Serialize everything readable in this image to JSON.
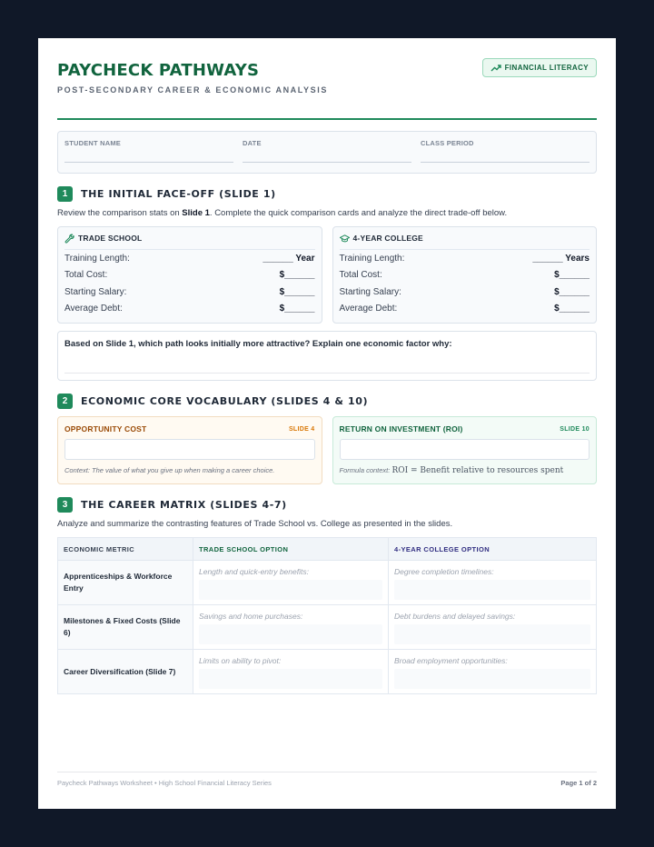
{
  "header": {
    "title": "PAYCHECK PATHWAYS",
    "subtitle": "POST-SECONDARY CAREER & ECONOMIC ANALYSIS",
    "badge": "FINANCIAL LITERACY"
  },
  "student_info": [
    {
      "label": "STUDENT NAME"
    },
    {
      "label": "DATE"
    },
    {
      "label": "CLASS PERIOD"
    }
  ],
  "section1": {
    "number": "1",
    "title": "THE INITIAL FACE-OFF (SLIDE 1)",
    "desc_pre": "Review the comparison stats on ",
    "desc_bold": "Slide 1",
    "desc_post": ". Complete the quick comparison cards and analyze the direct trade-off below.",
    "cards": [
      {
        "title": "TRADE SCHOOL",
        "icon": "wrench-icon",
        "rows": [
          {
            "label": "Training Length:",
            "value": "______ Year"
          },
          {
            "label": "Total Cost:",
            "value": "$______"
          },
          {
            "label": "Starting Salary:",
            "value": "$______"
          },
          {
            "label": "Average Debt:",
            "value": "$______"
          }
        ]
      },
      {
        "title": "4-YEAR COLLEGE",
        "icon": "graduation-cap-icon",
        "rows": [
          {
            "label": "Training Length:",
            "value": "______ Years"
          },
          {
            "label": "Total Cost:",
            "value": "$______"
          },
          {
            "label": "Starting Salary:",
            "value": "$______"
          },
          {
            "label": "Average Debt:",
            "value": "$______"
          }
        ]
      }
    ],
    "question": "Based on Slide 1, which path looks initially more attractive? Explain one economic factor why:"
  },
  "section2": {
    "number": "2",
    "title": "ECONOMIC CORE VOCABULARY (SLIDES 4 & 10)",
    "terms": [
      {
        "term": "OPPORTUNITY COST",
        "slide": "SLIDE 4",
        "note": "Context: The value of what you give up when making a career choice."
      },
      {
        "term": "RETURN ON INVESTMENT (ROI)",
        "slide": "SLIDE 10",
        "note_prefix": "Formula context: ",
        "formula": "ROI = Benefit relative to resources spent"
      }
    ]
  },
  "section3": {
    "number": "3",
    "title": "THE CAREER MATRIX (SLIDES 4-7)",
    "desc": "Analyze and summarize the contrasting features of Trade School vs. College as presented in the slides.",
    "columns": [
      "ECONOMIC METRIC",
      "TRADE SCHOOL OPTION",
      "4-YEAR COLLEGE OPTION"
    ],
    "rows": [
      {
        "metric": "Apprenticeships & Workforce Entry",
        "trade_hint": "Length and quick-entry benefits:",
        "college_hint": "Degree completion timelines:"
      },
      {
        "metric": "Milestones & Fixed Costs (Slide 6)",
        "trade_hint": "Savings and home purchases:",
        "college_hint": "Debt burdens and delayed savings:"
      },
      {
        "metric": "Career Diversification (Slide 7)",
        "trade_hint": "Limits on ability to pivot:",
        "college_hint": "Broad employment opportunities:"
      }
    ]
  },
  "footer": {
    "left": "Paycheck Pathways Worksheet • High School Financial Literacy Series",
    "right": "Page 1 of 2"
  },
  "colors": {
    "accent": "#1f8a5b",
    "title": "#11643e",
    "orange": "#d97706",
    "indigo": "#312e81",
    "background": "#101828"
  }
}
